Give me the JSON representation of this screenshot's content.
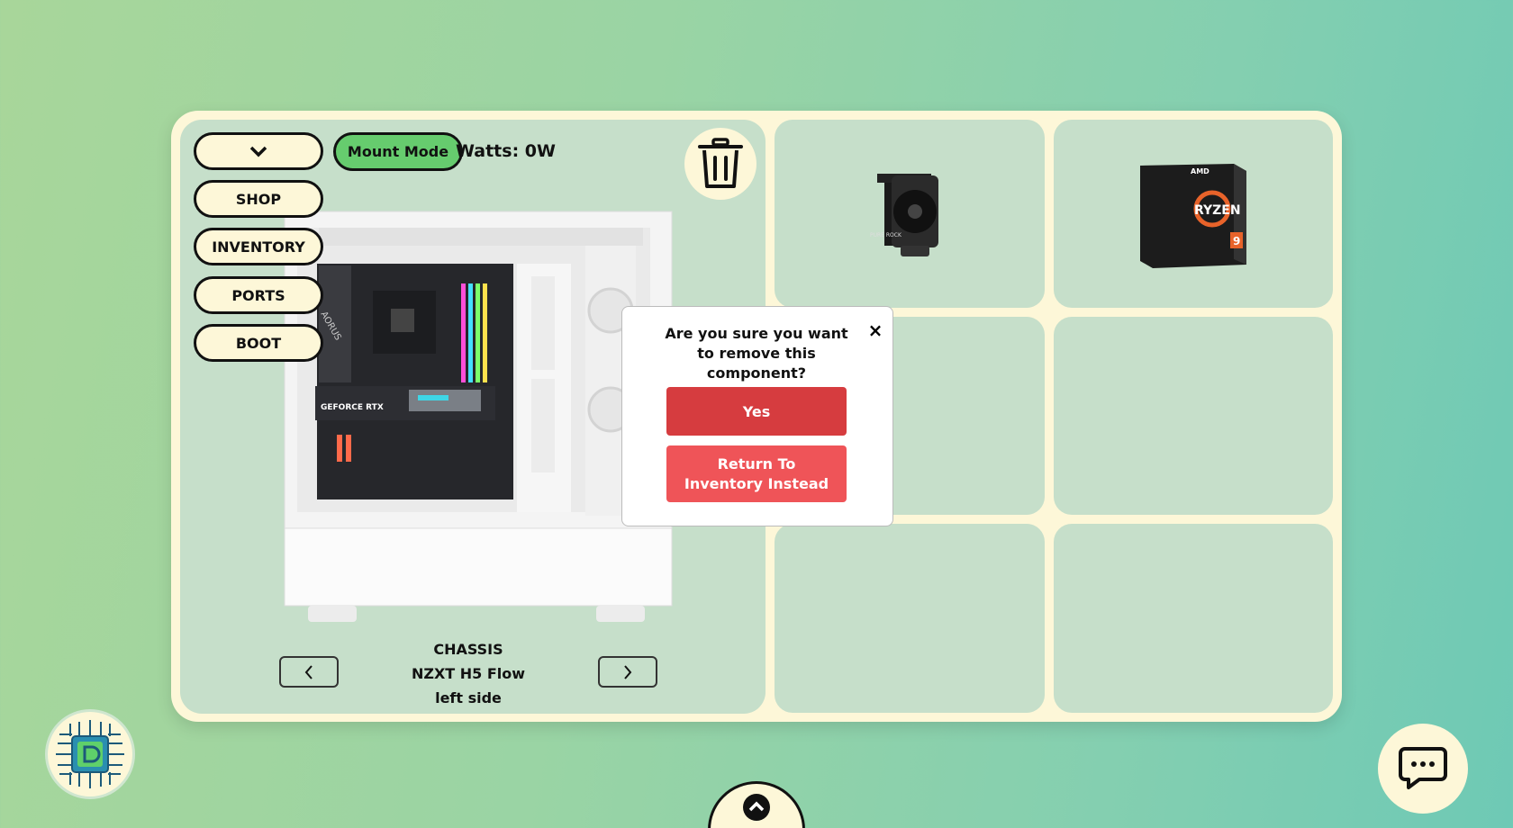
{
  "toolbar": {
    "dropdown_icon": "chevron-down-icon",
    "mount_mode_label": "Mount Mode",
    "watts_label": "Watts: 0W",
    "trash_icon": "trash-icon"
  },
  "menu": {
    "items": [
      {
        "label": "SHOP"
      },
      {
        "label": "INVENTORY"
      },
      {
        "label": "PORTS"
      },
      {
        "label": "BOOT"
      }
    ]
  },
  "viewer": {
    "category": "CHASSIS",
    "name": "NZXT H5 Flow",
    "view": "left side",
    "prev_icon": "chevron-left-icon",
    "next_icon": "chevron-right-icon"
  },
  "inventory": {
    "slots": [
      {
        "item": "cpu-cooler",
        "label": "PURE ROCK"
      },
      {
        "item": "cpu-box",
        "brand": "AMD",
        "label": "RYZEN",
        "tier": "9"
      },
      {
        "item": "empty"
      },
      {
        "item": "empty"
      },
      {
        "item": "empty"
      },
      {
        "item": "empty"
      }
    ]
  },
  "dialog": {
    "question": "Are you sure you want to remove this component?",
    "yes_label": "Yes",
    "return_label": "Return To Inventory Instead",
    "close_label": "×"
  },
  "colors": {
    "panel": "#c6dfca",
    "frame": "#fdf7d8",
    "mount_mode": "#66cc6e",
    "yes_button": "#d63c3f",
    "return_button": "#ef5458"
  },
  "case_art": {
    "gpu_label": "GEFORCE RTX",
    "mobo_label": "AORUS"
  }
}
